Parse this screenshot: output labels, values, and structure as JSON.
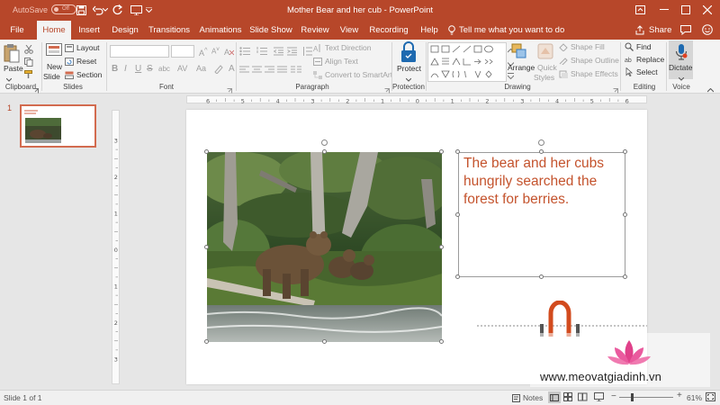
{
  "titlebar": {
    "autosave_label": "AutoSave",
    "autosave_state": "Off",
    "title": "Mother Bear and her cub  -  PowerPoint"
  },
  "tabs": [
    {
      "label": "File"
    },
    {
      "label": "Home"
    },
    {
      "label": "Insert"
    },
    {
      "label": "Design"
    },
    {
      "label": "Transitions"
    },
    {
      "label": "Animations"
    },
    {
      "label": "Slide Show"
    },
    {
      "label": "Review"
    },
    {
      "label": "View"
    },
    {
      "label": "Recording"
    },
    {
      "label": "Help"
    }
  ],
  "active_tab": "Home",
  "tell_me": "Tell me what you want to do",
  "share_label": "Share",
  "ribbon": {
    "clipboard": {
      "paste": "Paste",
      "group": "Clipboard"
    },
    "slides": {
      "new_slide": "New",
      "new_slide2": "Slide",
      "layout": "Layout",
      "reset": "Reset",
      "section": "Section",
      "group": "Slides"
    },
    "font": {
      "group": "Font",
      "bold": "B",
      "italic": "I",
      "underline": "U",
      "strike": "S",
      "shadow": "abc"
    },
    "paragraph": {
      "text_direction": "Text Direction",
      "align_text": "Align Text",
      "convert_smartart": "Convert to SmartArt",
      "group": "Paragraph"
    },
    "protection": {
      "protect": "Protect",
      "group": "Protection"
    },
    "drawing": {
      "arrange": "Arrange",
      "quick_styles": "Quick",
      "quick_styles2": "Styles",
      "shape_fill": "Shape Fill",
      "shape_outline": "Shape Outline",
      "shape_effects": "Shape Effects",
      "group": "Drawing"
    },
    "editing": {
      "find": "Find",
      "replace": "Replace",
      "select": "Select",
      "group": "Editing"
    },
    "voice": {
      "dictate": "Dictate",
      "group": "Voice"
    }
  },
  "slide_panel": {
    "slide_number": "1"
  },
  "slide": {
    "text": "The bear and her cubs hungrily searched the forest for berries."
  },
  "hruler_labels": [
    "6",
    "5",
    "4",
    "3",
    "2",
    "1",
    "0",
    "1",
    "2",
    "3",
    "4",
    "5",
    "6"
  ],
  "vruler_labels": [
    "3",
    "2",
    "1",
    "0",
    "1",
    "2",
    "3"
  ],
  "status": {
    "slide_info": "Slide 1 of 1",
    "notes": "Notes",
    "zoom": "61%"
  },
  "watermark": {
    "text": "www.meovatgiadinh.vn"
  },
  "colors": {
    "accent": "#b7472a",
    "slide_text": "#c4532d"
  }
}
